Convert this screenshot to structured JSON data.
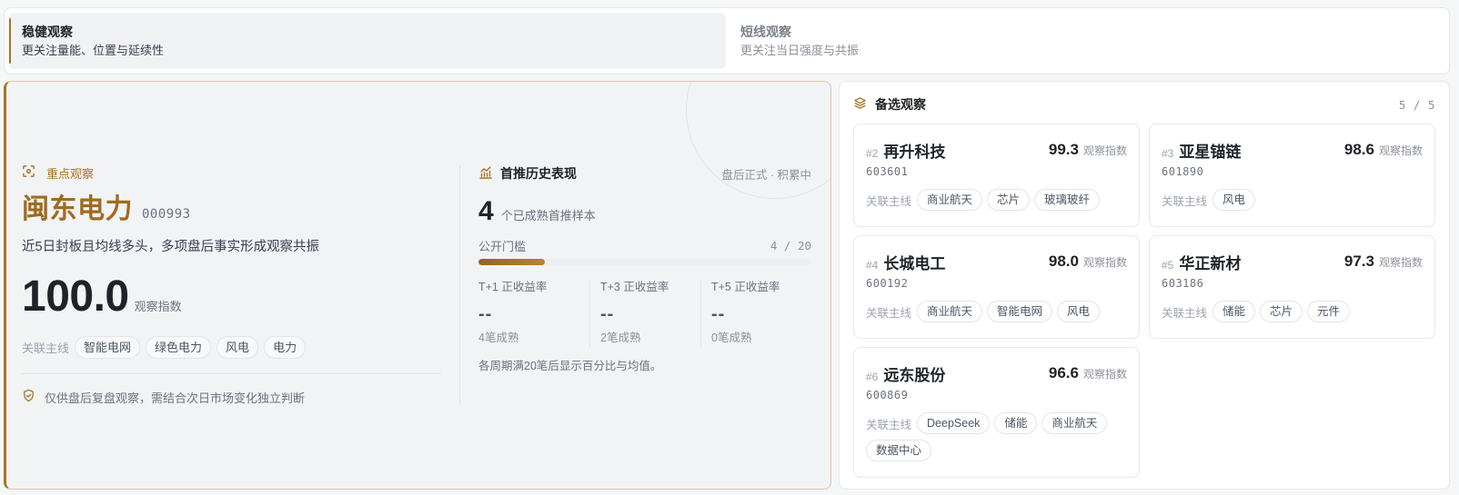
{
  "colors": {
    "accent": "#a8731f"
  },
  "tabs": [
    {
      "title": "稳健观察",
      "subtitle": "更关注量能、位置与延续性",
      "active": true
    },
    {
      "title": "短线观察",
      "subtitle": "更关注当日强度与共振",
      "active": false
    }
  ],
  "focus": {
    "label": "重点观察",
    "name": "闽东电力",
    "code": "000993",
    "description": "近5日封板且均线多头，多项盘后事实形成观察共振",
    "score": "100.0",
    "score_label": "观察指数",
    "themes_label": "关联主线",
    "themes": [
      "智能电网",
      "绿色电力",
      "风电",
      "电力"
    ],
    "disclaimer": "仅供盘后复盘观察，需结合次日市场变化独立判断"
  },
  "history": {
    "title": "首推历史表现",
    "status": "盘后正式 · 积累中",
    "sample_count": "4",
    "sample_label": "个已成熟首推样本",
    "threshold_label": "公开门槛",
    "threshold_text": "4 / 20",
    "progress": 0.2,
    "periods": [
      {
        "label": "T+1 正收益率",
        "value": "--",
        "matured": "4笔成熟"
      },
      {
        "label": "T+3 正收益率",
        "value": "--",
        "matured": "2笔成熟"
      },
      {
        "label": "T+5 正收益率",
        "value": "--",
        "matured": "0笔成熟"
      }
    ],
    "note": "各周期满20笔后显示百分比与均值。"
  },
  "candidates": {
    "title": "备选观察",
    "count": "5 / 5",
    "score_label": "观察指数",
    "themes_label": "关联主线",
    "items": [
      {
        "rank": "#2",
        "name": "再升科技",
        "code": "603601",
        "score": "99.3",
        "themes": [
          "商业航天",
          "芯片",
          "玻璃玻纤"
        ]
      },
      {
        "rank": "#3",
        "name": "亚星锚链",
        "code": "601890",
        "score": "98.6",
        "themes": [
          "风电"
        ]
      },
      {
        "rank": "#4",
        "name": "长城电工",
        "code": "600192",
        "score": "98.0",
        "themes": [
          "商业航天",
          "智能电网",
          "风电"
        ]
      },
      {
        "rank": "#5",
        "name": "华正新材",
        "code": "603186",
        "score": "97.3",
        "themes": [
          "储能",
          "芯片",
          "元件"
        ]
      },
      {
        "rank": "#6",
        "name": "远东股份",
        "code": "600869",
        "score": "96.6",
        "themes": [
          "DeepSeek",
          "储能",
          "商业航天",
          "数据中心"
        ]
      }
    ]
  }
}
